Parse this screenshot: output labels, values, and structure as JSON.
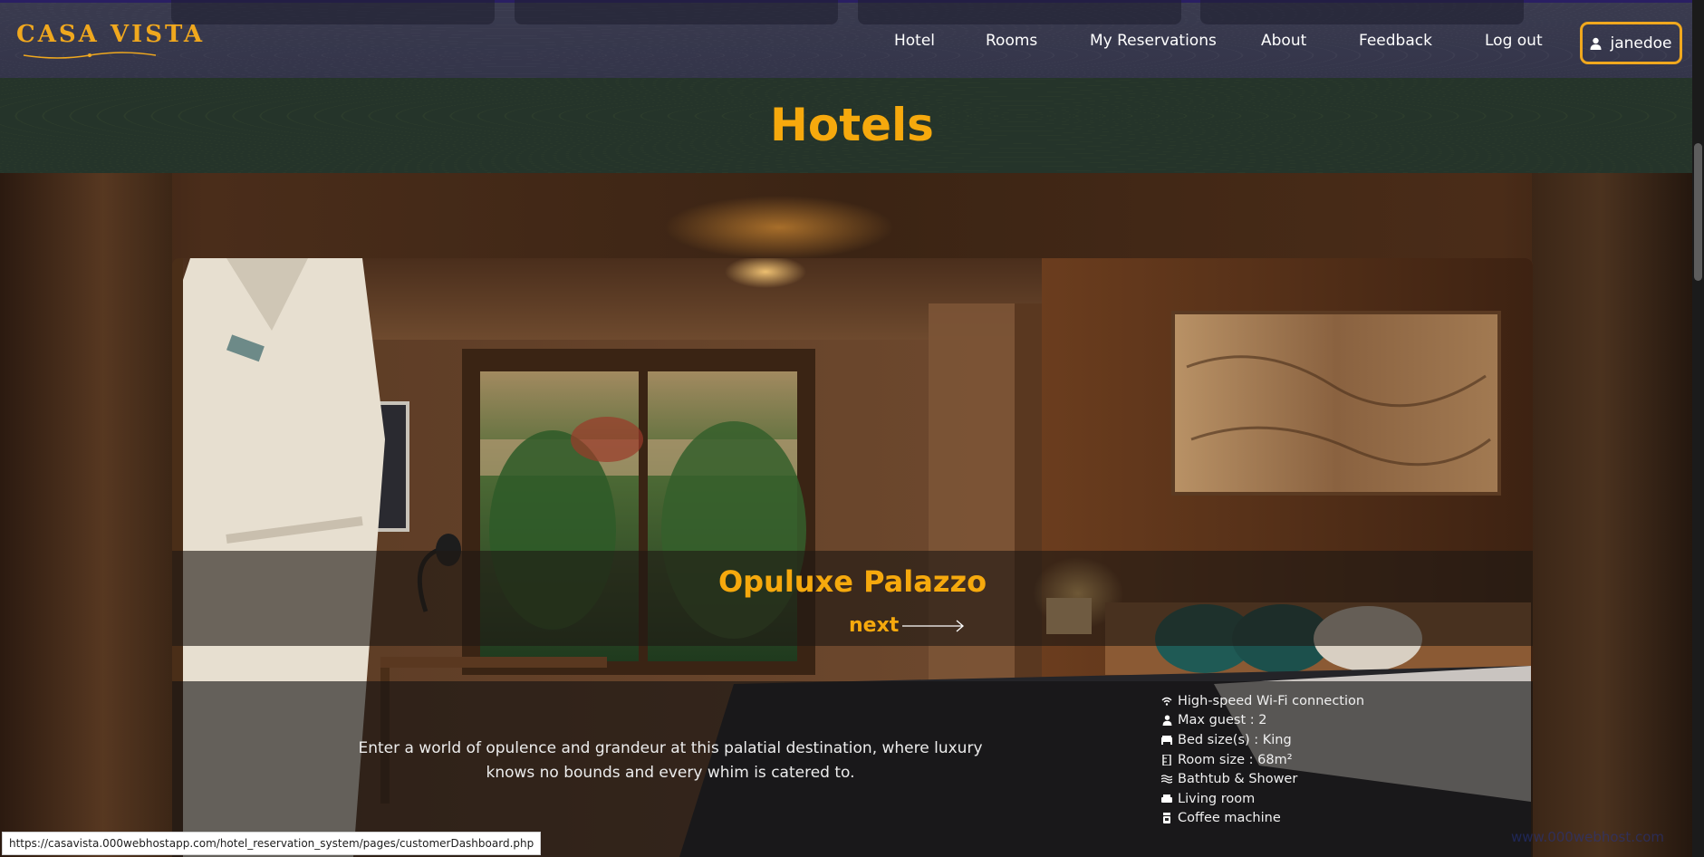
{
  "navbar": {
    "logo": "CASA VISTA",
    "links": [
      {
        "label": "Hotel"
      },
      {
        "label": "Rooms"
      },
      {
        "label": "My Reservations"
      },
      {
        "label": "About"
      },
      {
        "label": "Feedback"
      },
      {
        "label": "Log out"
      }
    ],
    "user": {
      "username": "janedoe",
      "icon": "user-icon"
    }
  },
  "banner": {
    "title": "Hotels"
  },
  "hotel": {
    "name": "Opuluxe Palazzo",
    "next_label": "next",
    "description": "Enter a world of opulence and grandeur at this palatial destination, where luxury knows no bounds and every whim is catered to.",
    "amenities": [
      {
        "icon": "wifi-icon",
        "label": "High-speed Wi-Fi connection"
      },
      {
        "icon": "user-icon",
        "label": "Max guest : 2"
      },
      {
        "icon": "bed-icon",
        "label": "Bed size(s) : King"
      },
      {
        "icon": "ruler-icon",
        "label": "Room size : 68m²"
      },
      {
        "icon": "bathtub-icon",
        "label": "Bathtub & Shower"
      },
      {
        "icon": "sofa-icon",
        "label": "Living room"
      },
      {
        "icon": "coffee-icon",
        "label": "Coffee machine"
      }
    ]
  },
  "status_bar": {
    "url": "https://casavista.000webhostapp.com/hotel_reservation_system/pages/customerDashboard.php"
  },
  "watermark": "www.000webhost.com",
  "colors": {
    "accent": "#f6a90d",
    "navbar": "#363749",
    "banner": "#25342a"
  }
}
